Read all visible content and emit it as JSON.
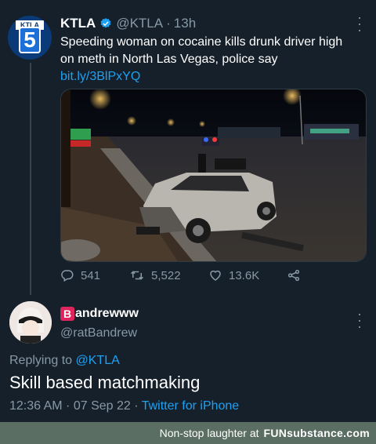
{
  "tweet1": {
    "display_name": "KTLA",
    "handle": "@KTLA",
    "separator": "·",
    "time": "13h",
    "avatar_text": "KTLA",
    "avatar_number": "5",
    "text": "Speeding woman on cocaine kills drunk driver high on meth in North Las Vegas, police say ",
    "link": "bit.ly/3BlPxYQ",
    "stats": {
      "replies": "541",
      "retweets": "5,522",
      "likes": "13.6K"
    }
  },
  "tweet2": {
    "badge_letter": "B",
    "display_name": "andrewww",
    "handle": "@ratBandrew",
    "replying_prefix": "Replying to ",
    "replying_to": "@KTLA",
    "text": "Skill based matchmaking",
    "timestamp": "12:36 AM · 07 Sep 22 · ",
    "client": "Twitter for iPhone"
  },
  "footer": {
    "tagline": "Non-stop laughter at",
    "brand": "FUNsubstance.com"
  },
  "icons": {
    "verified": "verified-badge-icon",
    "more": "more-options-icon",
    "reply": "reply-icon",
    "retweet": "retweet-icon",
    "like": "like-icon",
    "share": "share-icon"
  },
  "colors": {
    "background": "#15202b",
    "link": "#1da1f2",
    "secondary_text": "#8899a6",
    "footer_bg": "#5a6e64",
    "badge_red": "#e0245e"
  }
}
